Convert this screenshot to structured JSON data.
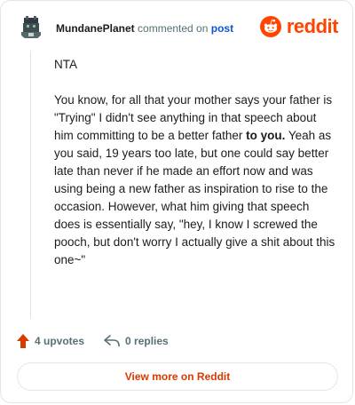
{
  "comment": {
    "username": "MundanePlanet",
    "action_text": "commented on",
    "post_link_text": "post",
    "paragraph1": "NTA",
    "paragraph2_part1": "You know, for all that your mother says your father is \"Trying\" I didn't see anything in that speech about him committing to be a better father ",
    "paragraph2_bold": "to you.",
    "paragraph2_part2": " Yeah as you said, 19 years too late, but one could say better late than never if he made an effort now and was using being a new father as inspiration to rise to the occasion. However, what him giving that speech does is essentially say, \"hey, I know I screwed the pooch, but don't worry I actually give a shit about this one~\""
  },
  "brand": {
    "wordmark": "reddit",
    "color": "#ff4500"
  },
  "actions": {
    "upvotes": "4 upvotes",
    "replies": "0 replies",
    "upvote_color": "#d93a00"
  },
  "footer": {
    "view_label": "View more on Reddit"
  },
  "icons": [
    "avatar",
    "reddit-snoo-icon",
    "upvote-arrow-icon",
    "reply-arrow-icon"
  ]
}
